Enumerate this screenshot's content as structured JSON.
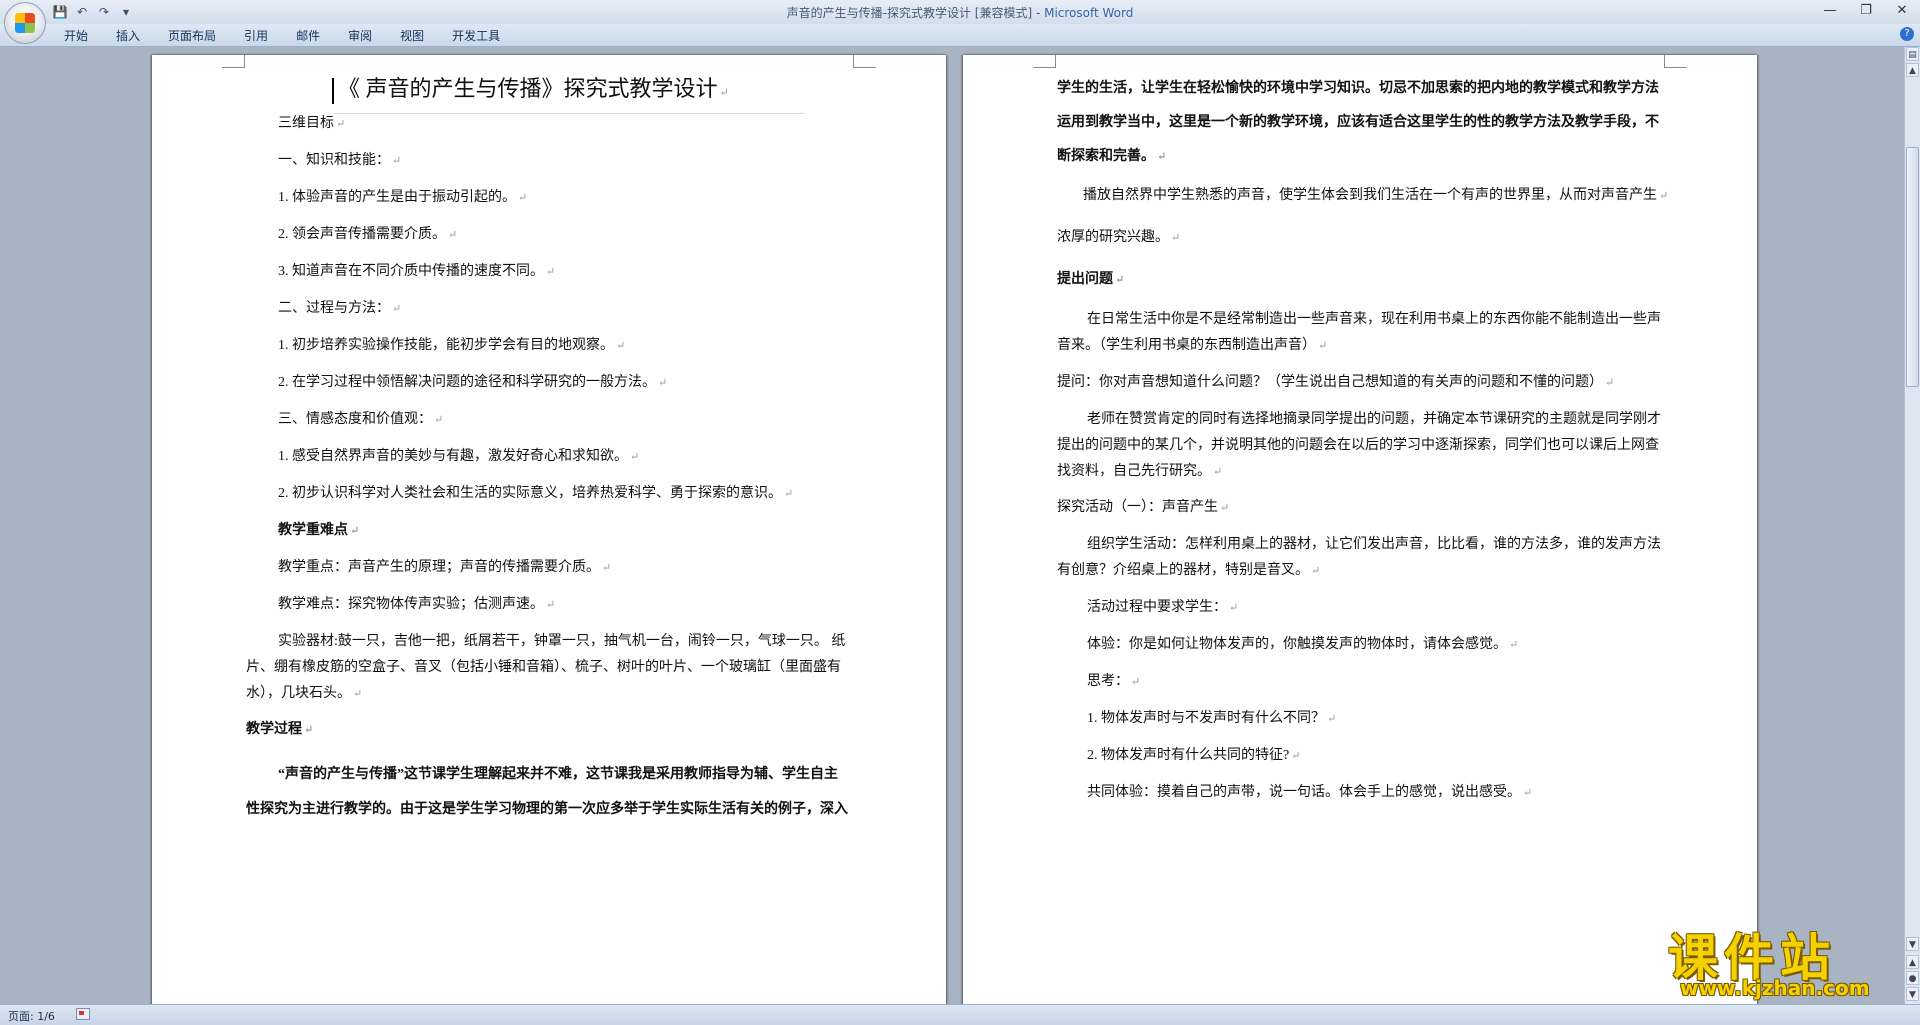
{
  "window": {
    "title_doc": "声音的产生与传播-探究式教学设计 [兼容模式] - ",
    "title_app": "Microsoft Word",
    "controls": [
      "—",
      "❐",
      "✕"
    ]
  },
  "qat": [
    "💾",
    "↶",
    "↷",
    "▾"
  ],
  "ribbon": {
    "tabs": [
      "开始",
      "插入",
      "页面布局",
      "引用",
      "邮件",
      "审阅",
      "视图",
      "开发工具"
    ],
    "help": "?"
  },
  "page1": {
    "title": "《 声音的产生与传播》探究式教学设计",
    "lines": [
      "三维目标",
      "一、知识和技能：",
      "1. 体验声音的产生是由于振动引起的。",
      "2. 领会声音传播需要介质。",
      "3. 知道声音在不同介质中传播的速度不同。",
      "二、过程与方法：",
      "1. 初步培养实验操作技能，能初步学会有目的地观察。",
      "2. 在学习过程中领悟解决问题的途径和科学研究的一般方法。",
      "三、情感态度和价值观：",
      "1. 感受自然界声音的美妙与有趣，激发好奇心和求知欲。",
      "2. 初步认识科学对人类社会和生活的实际意义，培养热爱科学、勇于探索的意识。",
      "教学重难点",
      "教学重点：声音产生的原理；声音的传播需要介质。",
      "教学难点：探究物体传声实验；估测声速。",
      "实验器材:鼓一只，吉他一把，纸屑若干，钟罩一只，抽气机一台，闹铃一只，气球一只。   纸",
      "片、绷有橡皮筋的空盒子、音叉（包括小锤和音箱）、梳子、树叶的叶片、一个玻璃缸（里面盛有",
      "水），几块石头。",
      "教学过程",
      "“声音的产生与传播”这节课学生理解起来并不难，这节课我是采用教师指导为辅、学生自主",
      "性探究为主进行教学的。由于这是学生学习物理的第一次应多举于学生实际生活有关的例子，深入"
    ]
  },
  "page2": {
    "lines": [
      "学生的生活，让学生在轻松愉快的环境中学习知识。切忌不加思索的把内地的教学模式和教学方法",
      "运用到教学当中，这里是一个新的教学环境，应该有适合这里学生的性的教学方法及教学手段，不",
      "断探索和完善。",
      "播放自然界中学生熟悉的声音，使学生体会到我们生活在一个有声的世界里，从而对声音产生",
      "浓厚的研究兴趣。",
      "提出问题",
      "在日常生活中你是不是经常制造出一些声音来，现在利用书桌上的东西你能不能制造出一些声",
      "音来。（学生利用书桌的东西制造出声音）",
      "提问：你对声音想知道什么问题？（学生说出自己想知道的有关声的问题和不懂的问题）",
      "老师在赞赏肯定的同时有选择地摘录同学提出的问题，并确定本节课研究的主题就是同学刚才",
      "提出的问题中的某几个，并说明其他的问题会在以后的学习中逐渐探索，同学们也可以课后上网查",
      "找资料，自己先行研究。",
      "探究活动（一）：声音产生",
      "组织学生活动：怎样利用桌上的器材，让它们发出声音，比比看，谁的方法多，谁的发声方法",
      "有创意？介绍桌上的器材，特别是音叉。",
      "活动过程中要求学生：",
      "体验：你是如何让物体发声的，你触摸发声的物体时，请体会感觉。",
      "思考：",
      "1. 物体发声时与不发声时有什么不同？",
      "2. 物体发声时有什么共同的特征?",
      "共同体验：摸着自己的声带，说一句话。体会手上的感觉，说出感受。"
    ]
  },
  "paragraph_mark": "↵",
  "statusbar": {
    "page": "页面: 1/6"
  },
  "watermark": {
    "title": "课件站",
    "url": "www.kjzhan.com"
  }
}
